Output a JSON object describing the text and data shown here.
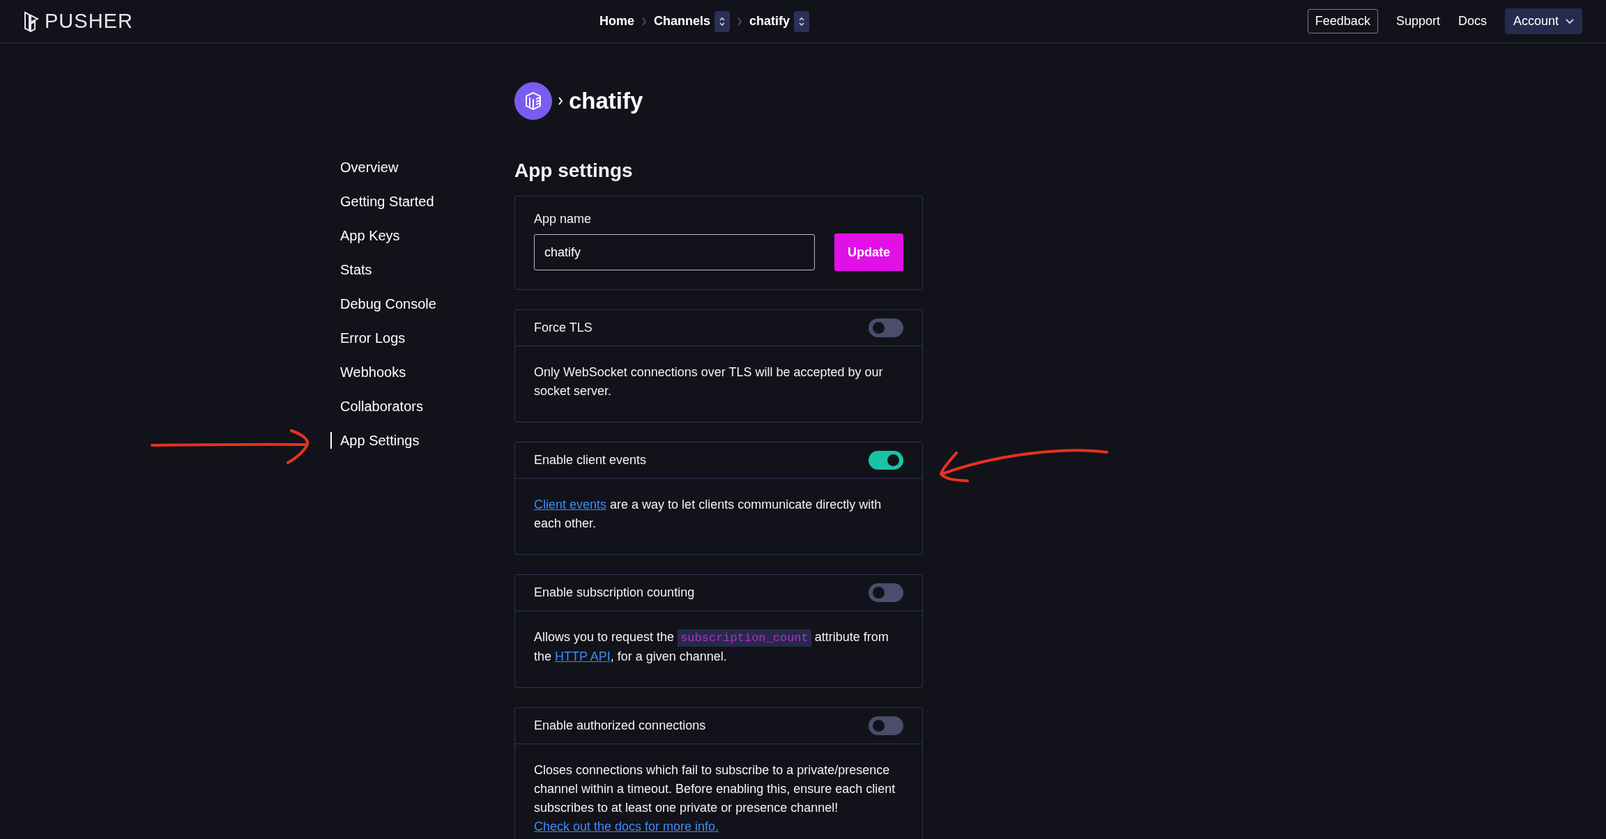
{
  "header": {
    "logo_text": "PUSHER",
    "breadcrumbs": [
      {
        "label": "Home",
        "has_switcher": false
      },
      {
        "label": "Channels",
        "has_switcher": true
      },
      {
        "label": "chatify",
        "has_switcher": true
      }
    ],
    "links": [
      {
        "label": "Feedback",
        "kind": "outlined"
      },
      {
        "label": "Support",
        "kind": "plain"
      },
      {
        "label": "Docs",
        "kind": "plain"
      },
      {
        "label": "Account",
        "kind": "menu"
      }
    ]
  },
  "sidebar": {
    "items": [
      {
        "label": "Overview",
        "selected": false
      },
      {
        "label": "Getting Started",
        "selected": false
      },
      {
        "label": "App Keys",
        "selected": false
      },
      {
        "label": "Stats",
        "selected": false
      },
      {
        "label": "Debug Console",
        "selected": false
      },
      {
        "label": "Error Logs",
        "selected": false
      },
      {
        "label": "Webhooks",
        "selected": false
      },
      {
        "label": "Collaborators",
        "selected": false
      },
      {
        "label": "App Settings",
        "selected": true
      }
    ]
  },
  "app_title": "chatify",
  "page_title": "App settings",
  "app_name": {
    "label": "App name",
    "value": "chatify",
    "button": "Update"
  },
  "settings": [
    {
      "title": "Force TLS",
      "on": false,
      "description": [
        {
          "kind": "text",
          "text": "Only WebSocket connections over TLS will be accepted by our socket server."
        }
      ]
    },
    {
      "title": "Enable client events",
      "on": true,
      "description": [
        {
          "kind": "link",
          "text": "Client events"
        },
        {
          "kind": "text",
          "text": " are a way to let clients communicate directly with each other."
        }
      ]
    },
    {
      "title": "Enable subscription counting",
      "on": false,
      "description": [
        {
          "kind": "text",
          "text": "Allows you to request the "
        },
        {
          "kind": "code",
          "text": "subscription_count"
        },
        {
          "kind": "text",
          "text": " attribute from the "
        },
        {
          "kind": "link",
          "text": "HTTP API"
        },
        {
          "kind": "text",
          "text": ", for a given channel."
        }
      ]
    },
    {
      "title": "Enable authorized connections",
      "on": false,
      "description": [
        {
          "kind": "text",
          "text": "Closes connections which fail to subscribe to a private/presence channel within a timeout. Before enabling this, ensure each client subscribes to at least one private or presence channel! "
        },
        {
          "kind": "link",
          "text": "Check out the docs for more info."
        }
      ]
    }
  ]
}
